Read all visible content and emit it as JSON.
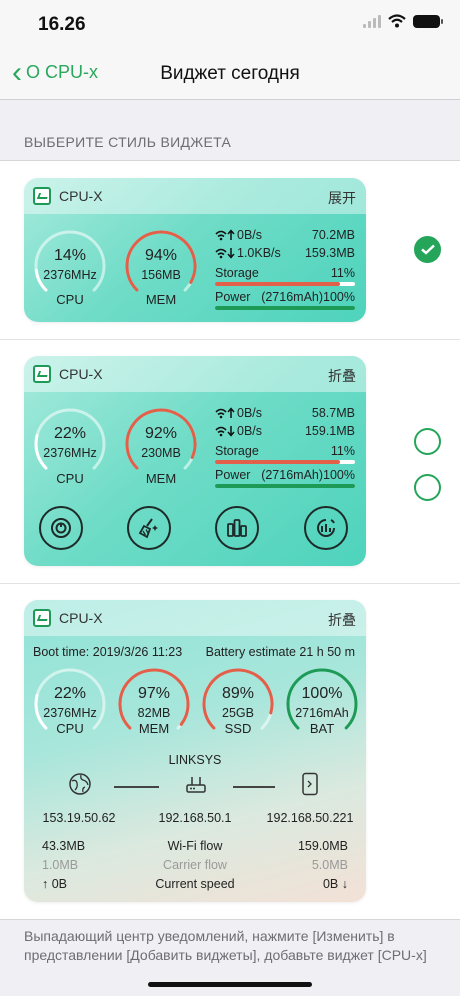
{
  "status": {
    "time": "16.26"
  },
  "nav": {
    "back_label": "О CPU-x",
    "title": "Виджет сегодня"
  },
  "section_header": "ВЫБЕРИТЕ СТИЛЬ ВИДЖЕТА",
  "colors": {
    "accent": "#24a55a",
    "cpu_ring": "#ffffff",
    "mem_ring": "#e2604a",
    "ssd_ring": "#e2604a",
    "bat_ring": "#1e9a57",
    "storage_bar": "#e2604a",
    "power_bar": "#1e9a57"
  },
  "widgets": [
    {
      "name": "CPU-X",
      "toggle": "展开",
      "selected": true,
      "cpu": {
        "value": "14%",
        "sub": "2376MHz",
        "label": "CPU",
        "fraction": 0.14
      },
      "mem": {
        "value": "94%",
        "sub": "156MB",
        "label": "MEM",
        "fraction": 0.94
      },
      "up_speed": "0B/s",
      "up_total": "70.2MB",
      "down_speed": "1.0KB/s",
      "down_total": "159.3MB",
      "storage_label": "Storage",
      "storage_value": "11%",
      "storage_fraction": 0.89,
      "power_label": "Power",
      "power_value": "(2716mAh)100%",
      "power_fraction": 1.0
    },
    {
      "name": "CPU-X",
      "toggle": "折叠",
      "selected": false,
      "cpu": {
        "value": "22%",
        "sub": "2376MHz",
        "label": "CPU",
        "fraction": 0.22
      },
      "mem": {
        "value": "92%",
        "sub": "230MB",
        "label": "MEM",
        "fraction": 0.92
      },
      "up_speed": "0B/s",
      "up_total": "58.7MB",
      "down_speed": "0B/s",
      "down_total": "159.1MB",
      "storage_label": "Storage",
      "storage_value": "11%",
      "storage_fraction": 0.89,
      "power_label": "Power",
      "power_value": "(2716mAh)100%",
      "power_fraction": 1.0,
      "tools": [
        "power-icon",
        "clean-broom-icon",
        "apps-icon",
        "speed-test-icon"
      ]
    },
    {
      "name": "CPU-X",
      "toggle": "折叠",
      "selected": false,
      "boot_time": "Boot time: 2019/3/26 11:23",
      "battery_estimate": "Battery estimate 21 h 50 m",
      "cpu": {
        "value": "22%",
        "sub": "2376MHz",
        "label": "CPU",
        "fraction": 0.22
      },
      "mem": {
        "value": "97%",
        "sub": "82MB",
        "label": "MEM",
        "fraction": 0.97
      },
      "ssd": {
        "value": "89%",
        "sub": "25GB",
        "label": "SSD",
        "fraction": 0.89
      },
      "bat": {
        "value": "100%",
        "sub": "2716mAh",
        "label": "BAT",
        "fraction": 1.0
      },
      "network_name": "LINKSYS",
      "ip_public": "153.19.50.62",
      "ip_router": "192.168.50.1",
      "ip_device": "192.168.50.221",
      "wifi_up": "43.3MB",
      "wifi_label": "Wi-Fi flow",
      "wifi_down": "159.0MB",
      "carrier_up": "1.0MB",
      "carrier_label": "Carrier flow",
      "carrier_down": "5.0MB",
      "speed_up": "0B",
      "speed_label": "Current speed",
      "speed_down": "0B"
    }
  ],
  "footer": "Выпадающий центр уведомлений, нажмите [Изменить] в представлении [Добавить виджеты], добавьте виджет [CPU-x]"
}
